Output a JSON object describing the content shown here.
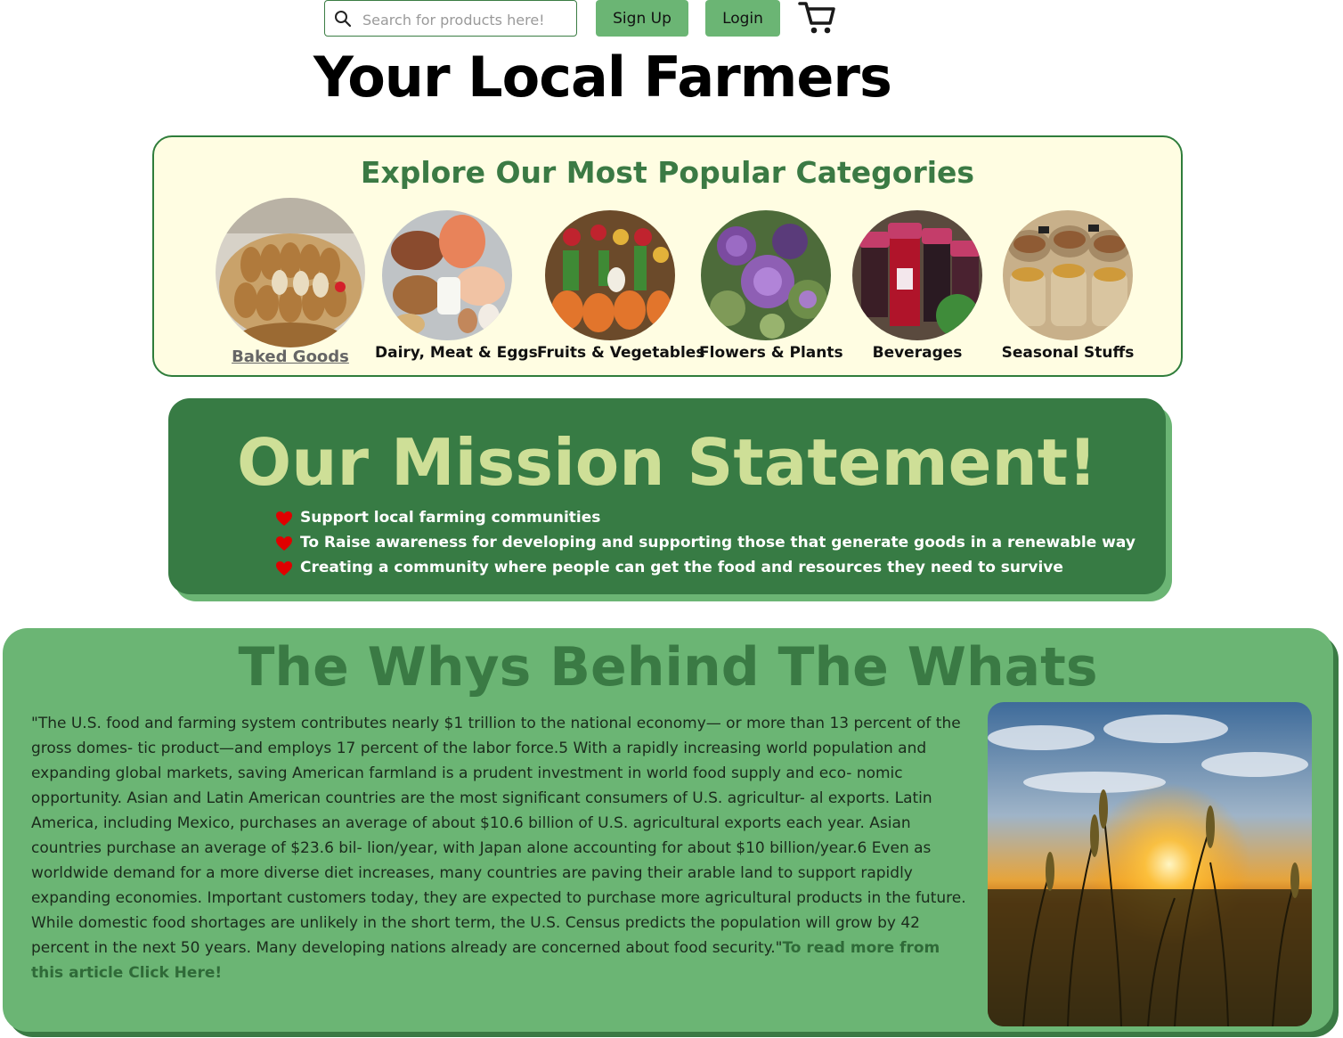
{
  "header": {
    "search_placeholder": "Search for products here!",
    "signup_label": "Sign Up",
    "login_label": "Login",
    "cart_icon": "cart-icon",
    "search_icon": "search-icon"
  },
  "site_title": "Your Local Farmers",
  "categories": {
    "heading": "Explore Our Most Popular Categories",
    "items": [
      {
        "label": "Baked Goods",
        "image": "baked-goods-image",
        "hovered": true
      },
      {
        "label": "Dairy, Meat & Eggs",
        "image": "dairy-meat-eggs-image"
      },
      {
        "label": "Fruits & Vegetables",
        "image": "fruits-vegetables-image"
      },
      {
        "label": "Flowers & Plants",
        "image": "flowers-plants-image"
      },
      {
        "label": "Beverages",
        "image": "beverages-image"
      },
      {
        "label": "Seasonal Stuffs",
        "image": "seasonal-stuffs-image"
      }
    ]
  },
  "mission": {
    "heading": "Our Mission Statement!",
    "bullets": [
      "Support local farming communities",
      "To Raise awareness for developing and supporting those that generate goods in a renewable way",
      "Creating a community where people can get the food and resources they need to survive"
    ],
    "bullet_icon": "heart-icon"
  },
  "whys": {
    "heading": "The Whys Behind The Whats",
    "quote": "\"The U.S. food and farming system contributes nearly $1 trillion to the national economy— or more than 13 percent of the gross domes- tic product—and employs 17 percent of the labor force.5 With a rapidly increasing world population and expanding global markets, saving American farmland is a prudent investment in world food supply and eco- nomic opportunity. Asian and Latin American countries are the most significant consumers of U.S. agricultur- al exports. Latin America, including Mexico, purchases an average of about $10.6 billion of U.S. agricultural exports each year. Asian countries purchase an average of $23.6 bil- lion/year, with Japan alone accounting for about $10 billion/year.6 Even as worldwide demand for a more diverse diet increases, many countries are paving their arable land to support rapidly expanding economies. Important customers today, they are expected to purchase more agricultural products in the future. While domestic food shortages are unlikely in the short term, the U.S. Census predicts the population will grow by 42 percent in the next 50 years. Many developing nations already are concerned about food security.\"",
    "link_label": "To read more from this article Click Here!",
    "image": "wheat-field-sunset-image"
  },
  "colors": {
    "dark_green": "#377b44",
    "light_green": "#6bb574",
    "cream": "#fffde2",
    "mission_heading": "#cedf97",
    "heart": "#e00000"
  }
}
